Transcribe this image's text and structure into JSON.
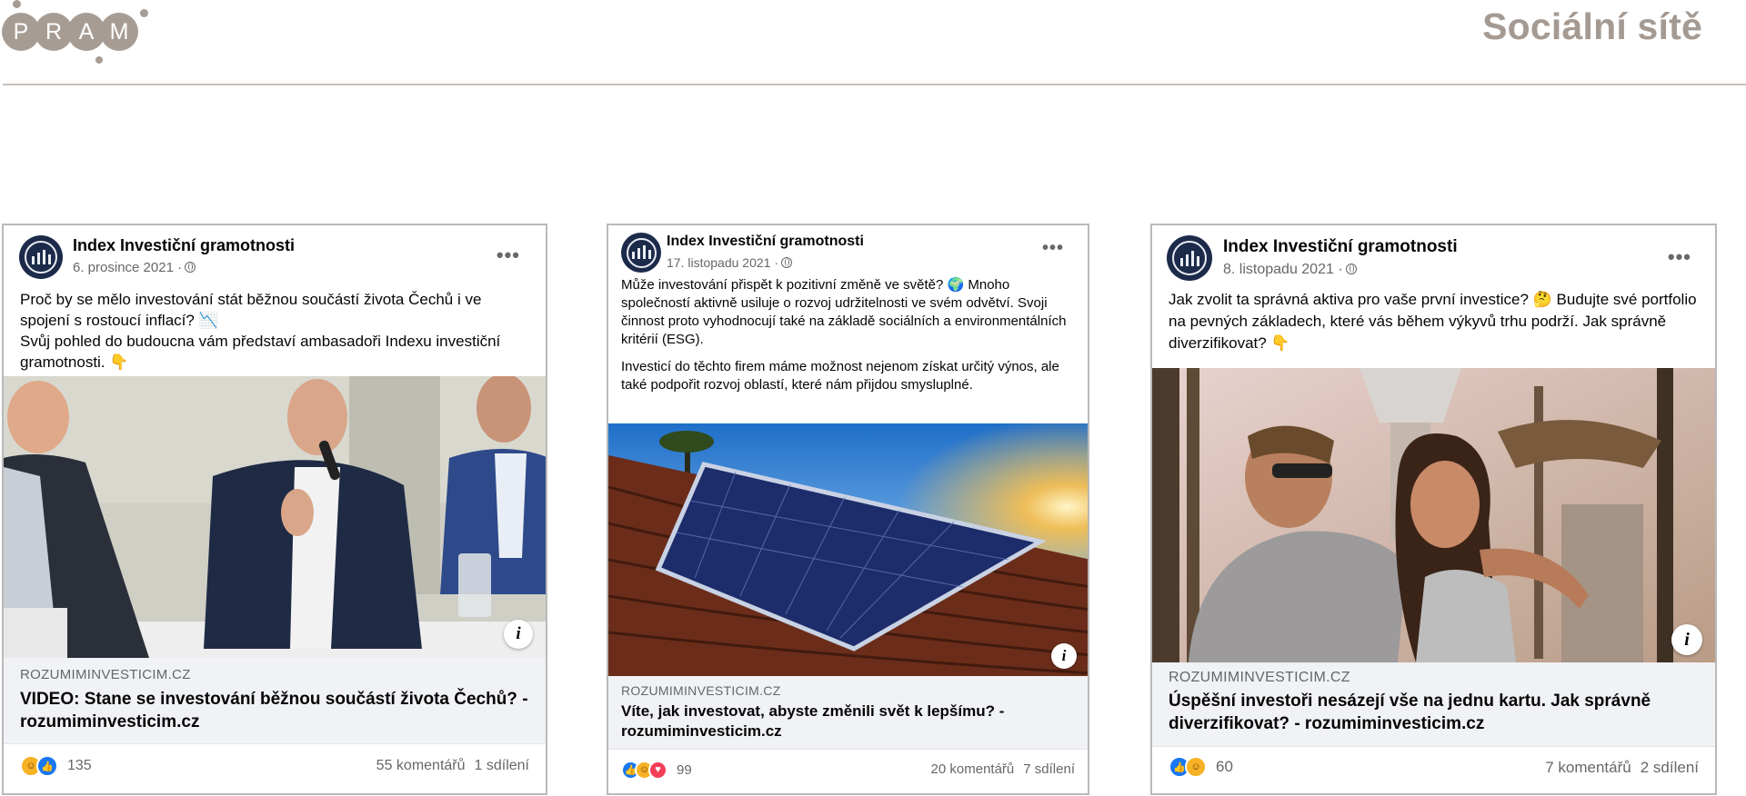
{
  "header": {
    "logo_letters": [
      "P",
      "R",
      "A",
      "M"
    ],
    "title": "Sociální sítě"
  },
  "posts": [
    {
      "author": "Index Investiční gramotnosti",
      "date": "6. prosince 2021 ·",
      "text": [
        "Proč by se mělo investování stát běžnou součástí života Čechů i ve spojení s rostoucí inflací? 📉",
        "Svůj pohled do budoucna vám představí ambasadoři Indexu investiční gramotnosti. 👇"
      ],
      "image_description_icon": "people-photo",
      "link_domain": "ROZUMIMINVESTICIM.CZ",
      "link_title": "VIDEO: Stane se investování běžnou součástí života Čechů? - rozumiminvesticim.cz",
      "reactions": [
        "haha",
        "like"
      ],
      "reaction_count": "135",
      "comments": "55 komentářů",
      "shares": "1 sdílení"
    },
    {
      "author": "Index Investiční gramotnosti",
      "date": "17. listopadu 2021 ·",
      "text": [
        "Může investování přispět k pozitivní změně ve světě? 🌍 Mnoho společností aktivně usiluje o rozvoj udržitelnosti ve svém odvětví. Svoji činnost proto vyhodnocují také na základě sociálních a environmentálních kritérií (ESG).",
        "Investicí do těchto firem máme možnost nejenom získat určitý výnos, ale také podpořit rozvoj oblastí, které nám přijdou smysluplné."
      ],
      "image_description_icon": "solar-panel-photo",
      "link_domain": "ROZUMIMINVESTICIM.CZ",
      "link_title": "Víte, jak investovat, abyste změnili svět k lepšímu? - rozumiminvesticim.cz",
      "reactions": [
        "like",
        "haha",
        "love"
      ],
      "reaction_count": "99",
      "comments": "20 komentářů",
      "shares": "7 sdílení"
    },
    {
      "author": "Index Investiční gramotnosti",
      "date": "8. listopadu 2021 ·",
      "text": [
        "Jak zvolit ta správná aktiva pro vaše první investice? 🤔 Budujte své portfolio na pevných základech, které vás během výkyvů trhu podrží. Jak správně diverzifikovat? 👇"
      ],
      "image_description_icon": "couple-photo",
      "link_domain": "ROZUMIMINVESTICIM.CZ",
      "link_title": "Úspěšní investoři nesázejí vše na jednu kartu. Jak správně diverzifikovat? - rozumiminvesticim.cz",
      "reactions": [
        "like",
        "haha"
      ],
      "reaction_count": "60",
      "comments": "7 komentářů",
      "shares": "2 sdílení"
    }
  ]
}
